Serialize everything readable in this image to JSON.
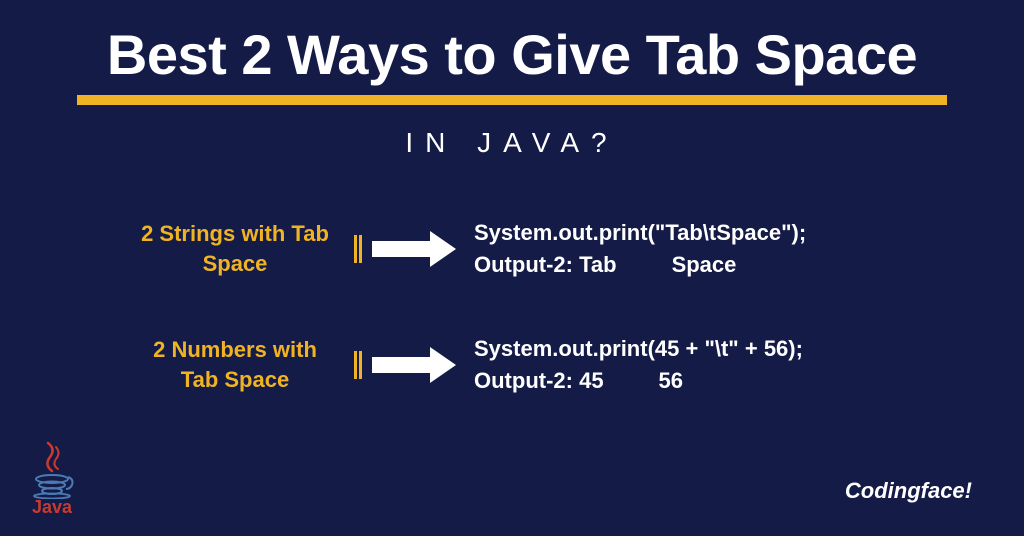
{
  "title": "Best 2 Ways to Give Tab Space",
  "subtitle": "IN JAVA?",
  "rows": [
    {
      "label": "2 Strings with\nTab Space",
      "code": "System.out.print(\"Tab\\tSpace\");\nOutput-2: Tab         Space"
    },
    {
      "label": "2 Numbers with\nTab Space",
      "code": "System.out.print(45 + \"\\t\" + 56);\nOutput-2: 45         56"
    }
  ],
  "logo_text": "Java",
  "brand": "Codingface!"
}
